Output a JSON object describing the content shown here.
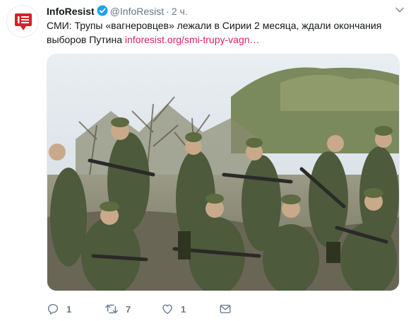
{
  "tweet": {
    "author_name": "InfoResist",
    "author_handle": "@InfoResist",
    "separator": "·",
    "time": "2 ч.",
    "text": "СМИ: Трупы «вагнеровцев» лежали в Сирии 2 месяца, ждали окончания выборов Путина ",
    "link_text": "inforesist.org/smi-trupy-vagn…",
    "image_icon": "group-photo-soldiers"
  },
  "actions": {
    "reply_count": "1",
    "retweet_count": "7",
    "like_count": "1"
  },
  "colors": {
    "link": "#e0245e",
    "muted": "#657786",
    "verified": "#1da1f2",
    "avatar_red": "#d6202a"
  }
}
